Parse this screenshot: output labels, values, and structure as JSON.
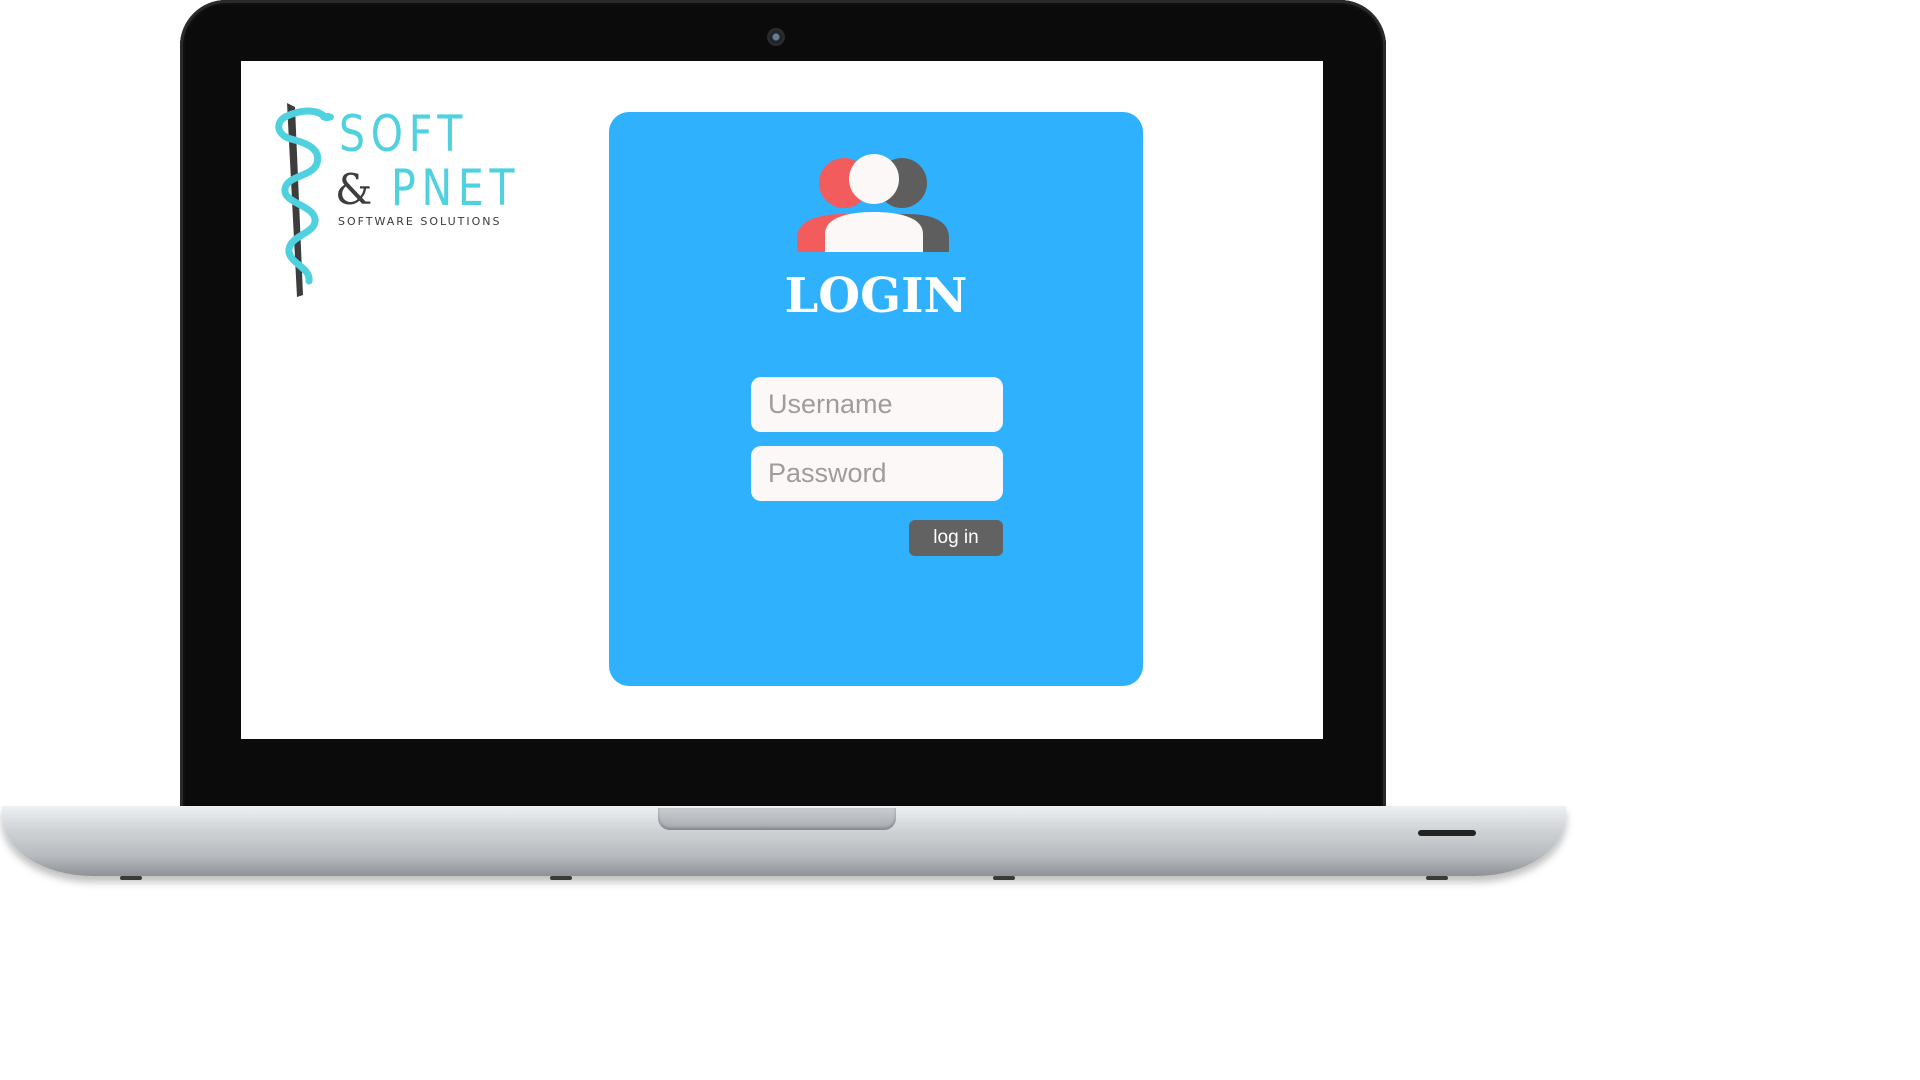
{
  "logo": {
    "line1": "SOFT",
    "ampersand": "&",
    "line2": "PNET",
    "tagline": "SOFTWARE SOLUTIONS"
  },
  "login": {
    "icon": "users-icon",
    "title": "LOGIN",
    "username_placeholder": "Username",
    "password_placeholder": "Password",
    "button_label": "log in"
  },
  "colors": {
    "card_background": "#30b1fd",
    "button_background": "#626262",
    "logo_accent": "#4fd1df",
    "user_icon_left": "#f25c5c",
    "user_icon_center": "#fbf8f7",
    "user_icon_right": "#5e5e5e"
  }
}
